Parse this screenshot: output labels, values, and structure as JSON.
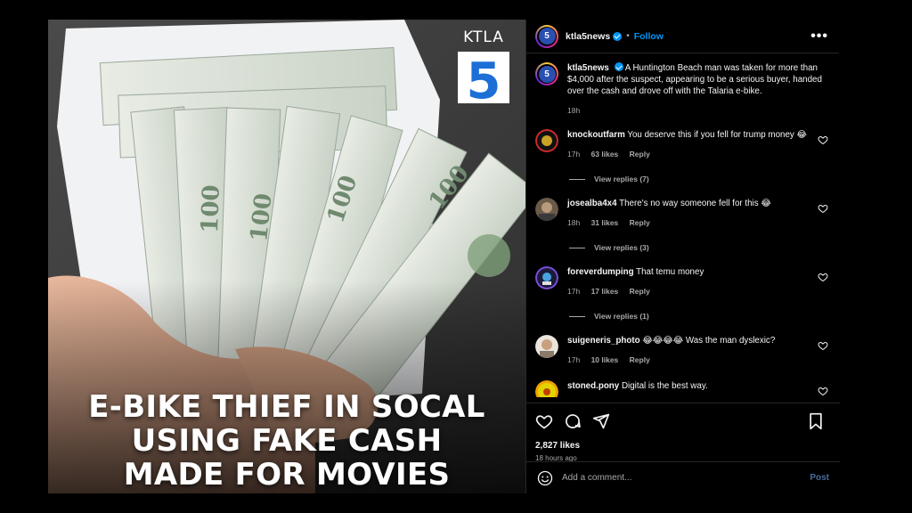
{
  "media": {
    "logo_text": "KTLA",
    "logo_number": "5",
    "headline_lines": [
      "E-BIKE THIEF IN SOCAL",
      "USING FAKE CASH",
      "MADE FOR MOVIES"
    ]
  },
  "header": {
    "username": "ktla5news",
    "separator": "•",
    "follow_label": "Follow",
    "more_label": "•••",
    "avatar_text": "5"
  },
  "caption": {
    "username": "ktla5news",
    "text": "A Huntington Beach man was taken for more than $4,000 after the suspect, appearing to be a serious buyer, handed over the cash and drove off with the Talaria e-bike.",
    "time": "18h"
  },
  "comments": [
    {
      "username": "knockoutfarm",
      "text": "You deserve this if you fell for trump money 😂",
      "time": "17h",
      "likes": "63 likes",
      "reply_label": "Reply",
      "view_replies": "View replies (7)"
    },
    {
      "username": "josealba4x4",
      "text": "There's no way someone fell for this 😂",
      "time": "18h",
      "likes": "31 likes",
      "reply_label": "Reply",
      "view_replies": "View replies (3)"
    },
    {
      "username": "foreverdumping",
      "text": "That temu money",
      "time": "17h",
      "likes": "17 likes",
      "reply_label": "Reply",
      "view_replies": "View replies (1)"
    },
    {
      "username": "suigeneris_photo",
      "text": "😂😂😂😂 Was the man dyslexic?",
      "time": "17h",
      "likes": "10 likes",
      "reply_label": "Reply",
      "view_replies": ""
    },
    {
      "username": "stoned.pony",
      "text": "Digital is the best way.",
      "time": "",
      "likes": "",
      "reply_label": "",
      "view_replies": ""
    }
  ],
  "actions": {
    "likes_count": "2,827 likes",
    "time_ago": "18 hours ago"
  },
  "add_comment": {
    "placeholder": "Add a comment...",
    "post_label": "Post"
  },
  "colors": {
    "accent": "#0095f6",
    "background": "#000000",
    "text": "#f5f5f5",
    "muted": "#a8a8a8"
  },
  "icons": [
    "heart-icon",
    "comment-icon",
    "share-icon",
    "bookmark-icon",
    "emoji-icon",
    "verified-icon",
    "more-icon"
  ]
}
